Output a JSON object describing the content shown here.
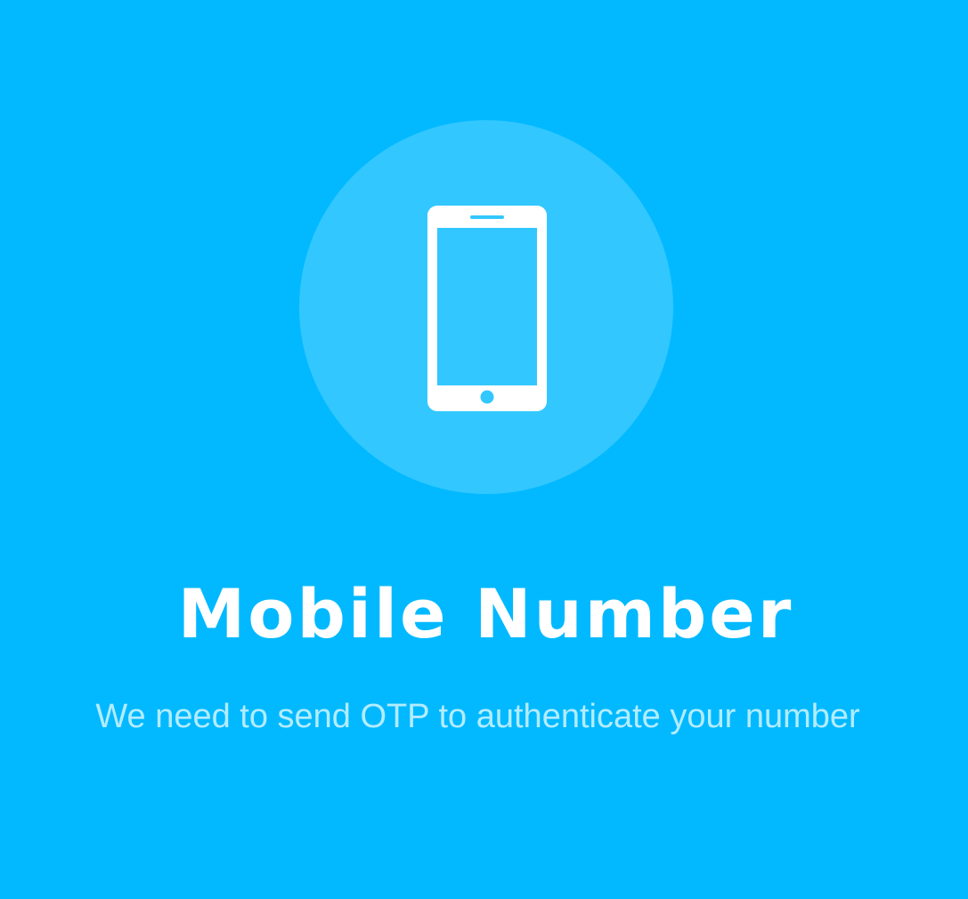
{
  "screen": {
    "background_color": "#02B9FF",
    "icon": {
      "name": "smartphone-icon",
      "circle_color": "#33C7FF",
      "icon_color": "#FFFFFF"
    },
    "title": "Mobile Number",
    "subtitle": "We need to send OTP to authenticate your number"
  }
}
